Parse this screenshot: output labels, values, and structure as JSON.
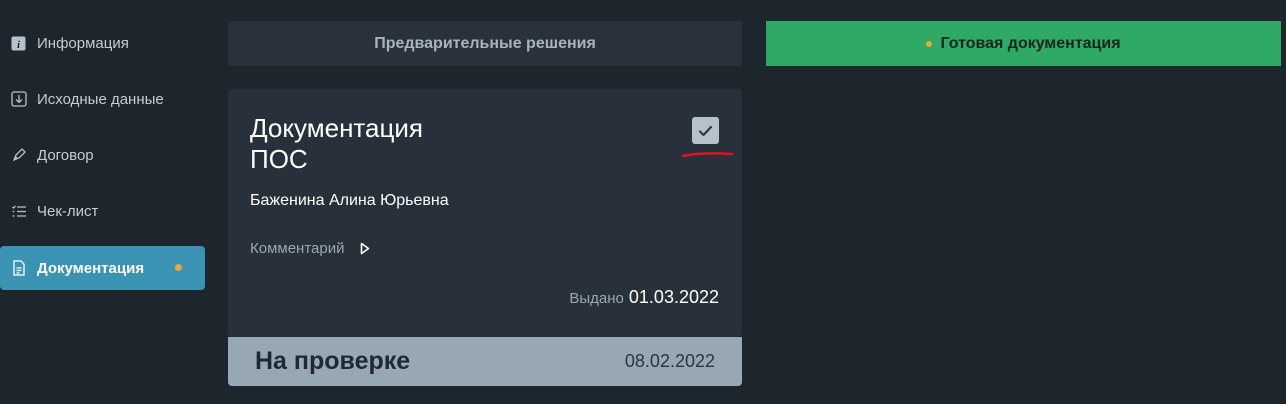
{
  "sidebar": {
    "items": [
      {
        "label": "Информация",
        "icon": "info-icon"
      },
      {
        "label": "Исходные данные",
        "icon": "download-icon"
      },
      {
        "label": "Договор",
        "icon": "pen-icon"
      },
      {
        "label": "Чек-лист",
        "icon": "checklist-icon"
      },
      {
        "label": "Документация",
        "icon": "document-icon",
        "active": true,
        "badge_color": "#f0a53a"
      }
    ]
  },
  "tabs": {
    "preliminary": "Предварительные решения",
    "ready": "Готовая документация",
    "ready_color": "#2eaa66"
  },
  "card": {
    "title_line1": "Документация",
    "title_line2": "ПОС",
    "checked": true,
    "person": "Баженина Алина Юрьевна",
    "comment_label": "Комментарий",
    "issued_label": "Выдано",
    "issued_date": "01.03.2022"
  },
  "status": {
    "label": "На проверке",
    "date": "08.02.2022"
  }
}
